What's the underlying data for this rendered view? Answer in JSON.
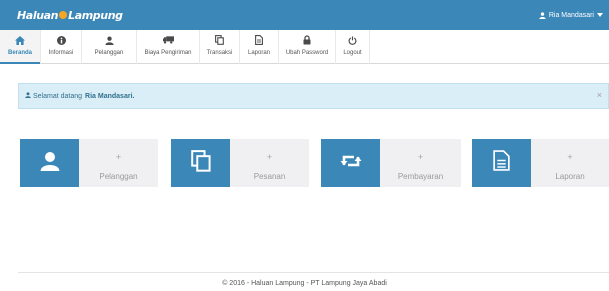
{
  "header": {
    "brand_left": "Haluan",
    "brand_right": "Lampung",
    "user_name": "Ria Mandasari"
  },
  "nav": {
    "items": [
      {
        "label": "Beranda",
        "icon": "home-icon",
        "active": true
      },
      {
        "label": "Informasi",
        "icon": "info-icon",
        "active": false
      },
      {
        "label": "Pelanggan",
        "icon": "user-icon",
        "active": false
      },
      {
        "label": "Biaya Pengiriman",
        "icon": "truck-icon",
        "active": false
      },
      {
        "label": "Transaksi",
        "icon": "copy-icon",
        "active": false
      },
      {
        "label": "Laporan",
        "icon": "document-icon",
        "active": false
      },
      {
        "label": "Ubah Password",
        "icon": "lock-icon",
        "active": false
      },
      {
        "label": "Logout",
        "icon": "power-icon",
        "active": false
      }
    ]
  },
  "alert": {
    "greeting": "Selamat datang",
    "user": "Ria Mandasari.",
    "close": "×"
  },
  "cards": [
    {
      "label": "Pelanggan",
      "plus": "+",
      "icon": "user-icon"
    },
    {
      "label": "Pesanan",
      "plus": "+",
      "icon": "copy-icon"
    },
    {
      "label": "Pembayaran",
      "plus": "+",
      "icon": "retweet-icon"
    },
    {
      "label": "Laporan",
      "plus": "+",
      "icon": "document-icon"
    }
  ],
  "footer": {
    "text": "© 2016 - Haluan Lampung - PT Lampung Jaya Abadi"
  },
  "colors": {
    "primary": "#3a87b8",
    "alert_bg": "#d9eef7",
    "alert_text": "#31708f",
    "card_bg": "#f0f0f2",
    "brand_accent": "#f5a623"
  }
}
